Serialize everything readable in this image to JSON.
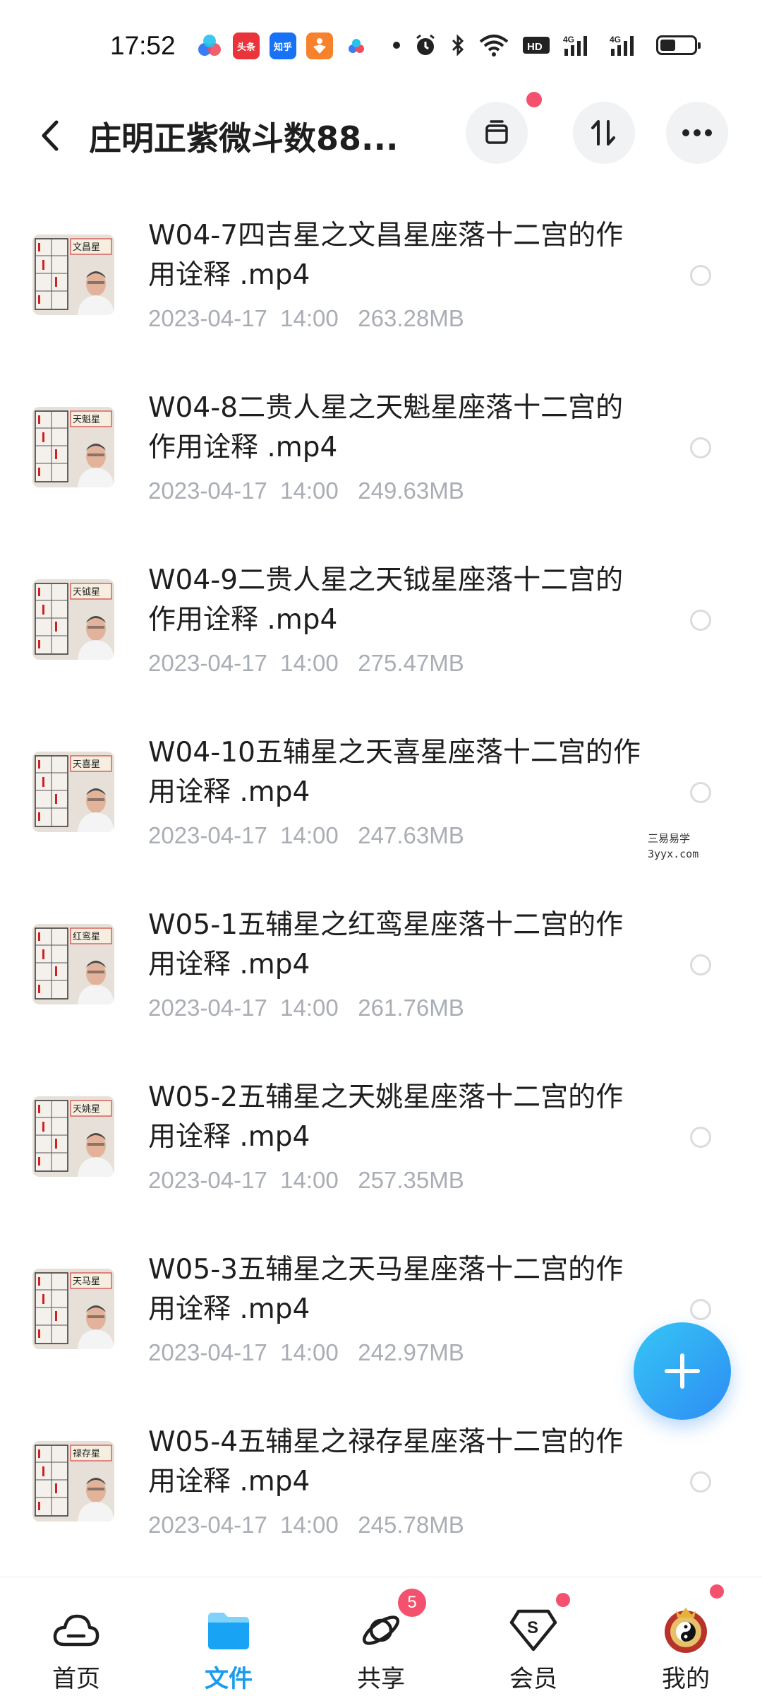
{
  "status_bar": {
    "time": "17:52",
    "app_icons": [
      "baidu-icon",
      "toutiao-icon",
      "zhihu-icon",
      "fitness-icon",
      "cloud-icon"
    ],
    "toutiao_label": "头条",
    "zhihu_label": "知乎",
    "network_label": "4G",
    "battery_level": 0.45
  },
  "header": {
    "title": "庄明正紫微斗数88..."
  },
  "files": [
    {
      "name": "W04-7四吉星之文昌星座落十二宫的作用诠释 .mp4",
      "date": "2023-04-17",
      "time": "14:00",
      "size": "263.28MB",
      "thumb_caption": "文昌星"
    },
    {
      "name": "W04-8二贵人星之天魁星座落十二宫的作用诠释 .mp4",
      "date": "2023-04-17",
      "time": "14:00",
      "size": "249.63MB",
      "thumb_caption": "天魁星"
    },
    {
      "name": "W04-9二贵人星之天钺星座落十二宫的作用诠释 .mp4",
      "date": "2023-04-17",
      "time": "14:00",
      "size": "275.47MB",
      "thumb_caption": "天钺星"
    },
    {
      "name": "W04-10五辅星之天喜星座落十二宫的作用诠释 .mp4",
      "date": "2023-04-17",
      "time": "14:00",
      "size": "247.63MB",
      "thumb_caption": "天喜星"
    },
    {
      "name": "W05-1五辅星之红鸾星座落十二宫的作用诠释 .mp4",
      "date": "2023-04-17",
      "time": "14:00",
      "size": "261.76MB",
      "thumb_caption": "红鸾星"
    },
    {
      "name": "W05-2五辅星之天姚星座落十二宫的作用诠释 .mp4",
      "date": "2023-04-17",
      "time": "14:00",
      "size": "257.35MB",
      "thumb_caption": "天姚星"
    },
    {
      "name": "W05-3五辅星之天马星座落十二宫的作用诠释 .mp4",
      "date": "2023-04-17",
      "time": "14:00",
      "size": "242.97MB",
      "thumb_caption": "天马星"
    },
    {
      "name": "W05-4五辅星之禄存星座落十二宫的作用诠释 .mp4",
      "date": "2023-04-17",
      "time": "14:00",
      "size": "245.78MB",
      "thumb_caption": "禄存星"
    }
  ],
  "watermark": {
    "line1": "三易易学",
    "line2": "3yyx.com"
  },
  "bottom_nav": [
    {
      "label": "首页",
      "icon": "home-cloud-icon",
      "active": false
    },
    {
      "label": "文件",
      "icon": "folder-icon",
      "active": true
    },
    {
      "label": "共享",
      "icon": "share-planet-icon",
      "active": false,
      "badge": "5"
    },
    {
      "label": "会员",
      "icon": "vip-diamond-icon",
      "active": false
    },
    {
      "label": "我的",
      "icon": "avatar-icon",
      "active": false
    }
  ],
  "colors": {
    "accent": "#1a9bf0",
    "badge": "#f3516d",
    "meta_text": "#a9adb4",
    "fab_gradient": [
      "#36c6f5",
      "#2d8cf4"
    ]
  }
}
